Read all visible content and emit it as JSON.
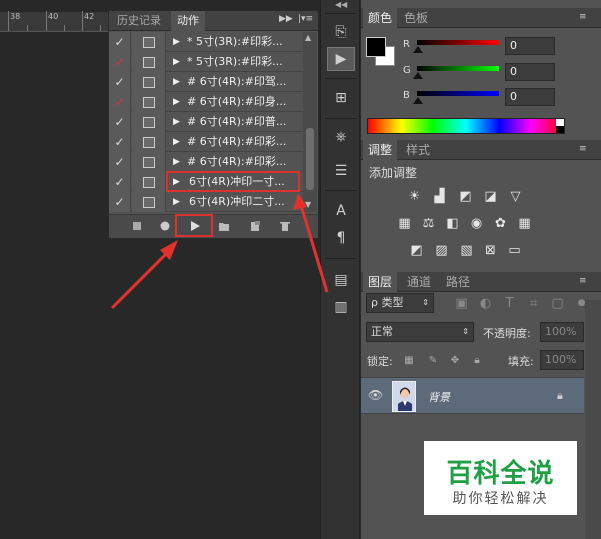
{
  "ruler": {
    "ticks": [
      "38",
      "40",
      "42"
    ]
  },
  "actions_panel": {
    "tabs": [
      "历史记录",
      "动作"
    ],
    "active_tab": "动作",
    "collapse_icon": "double-arrow-icon",
    "menu_icon": "panel-menu-icon",
    "rows": [
      {
        "check": "✓",
        "check_color": "#dddddd",
        "triangle": "▶",
        "name": "* 5寸(3R):#印彩..."
      },
      {
        "check": "✓",
        "check_color": "#d43a3a",
        "triangle": "▶",
        "name": "* 5寸(3R):#印彩..."
      },
      {
        "check": "✓",
        "check_color": "#dddddd",
        "triangle": "▶",
        "name": "# 6寸(4R):#印驾..."
      },
      {
        "check": "✓",
        "check_color": "#d43a3a",
        "triangle": "▶",
        "name": "# 6寸(4R):#印身..."
      },
      {
        "check": "✓",
        "check_color": "#dddddd",
        "triangle": "▶",
        "name": "# 6寸(4R):#印普..."
      },
      {
        "check": "✓",
        "check_color": "#dddddd",
        "triangle": "▶",
        "name": "# 6寸(4R):#印彩..."
      },
      {
        "check": "✓",
        "check_color": "#dddddd",
        "triangle": "▶",
        "name": "# 6寸(4R):#印彩..."
      },
      {
        "check": "✓",
        "check_color": "#dddddd",
        "triangle": "▶",
        "name": "6寸(4R)冲印一寸..."
      },
      {
        "check": "✓",
        "check_color": "#dddddd",
        "triangle": "▶",
        "name": "6寸(4R)冲印二寸..."
      }
    ],
    "selected_index": 7,
    "footer_buttons": [
      "stop-icon",
      "record-icon",
      "play-icon",
      "folder-icon",
      "new-action-icon",
      "delete-icon"
    ]
  },
  "color_panel": {
    "tabs": [
      "颜色",
      "色板"
    ],
    "active_tab": "颜色",
    "foreground": "#000000",
    "background": "#ffffff",
    "channels": [
      {
        "label": "R",
        "value": "0",
        "gradient": "#ff0000"
      },
      {
        "label": "G",
        "value": "0",
        "gradient": "#00ff00"
      },
      {
        "label": "B",
        "value": "0",
        "gradient": "#0000ff"
      }
    ]
  },
  "adjustments_panel": {
    "tabs": [
      "调整",
      "样式"
    ],
    "active_tab": "调整",
    "heading": "添加调整"
  },
  "layers_panel": {
    "tabs": [
      "图层",
      "通道",
      "路径"
    ],
    "active_tab": "图层",
    "filter_label": "ρ 类型",
    "blend_mode": "正常",
    "opacity_label": "不透明度:",
    "opacity_value": "100%",
    "lock_label": "锁定:",
    "fill_label": "填充:",
    "fill_value": "100%",
    "layers": [
      {
        "name": "背景",
        "visible": true,
        "locked": true
      }
    ]
  },
  "watermark": {
    "title": "百科全说",
    "subtitle": "助你轻松解决"
  },
  "colors": {
    "highlight_red": "#d9332f",
    "panel_bg": "#535353"
  }
}
